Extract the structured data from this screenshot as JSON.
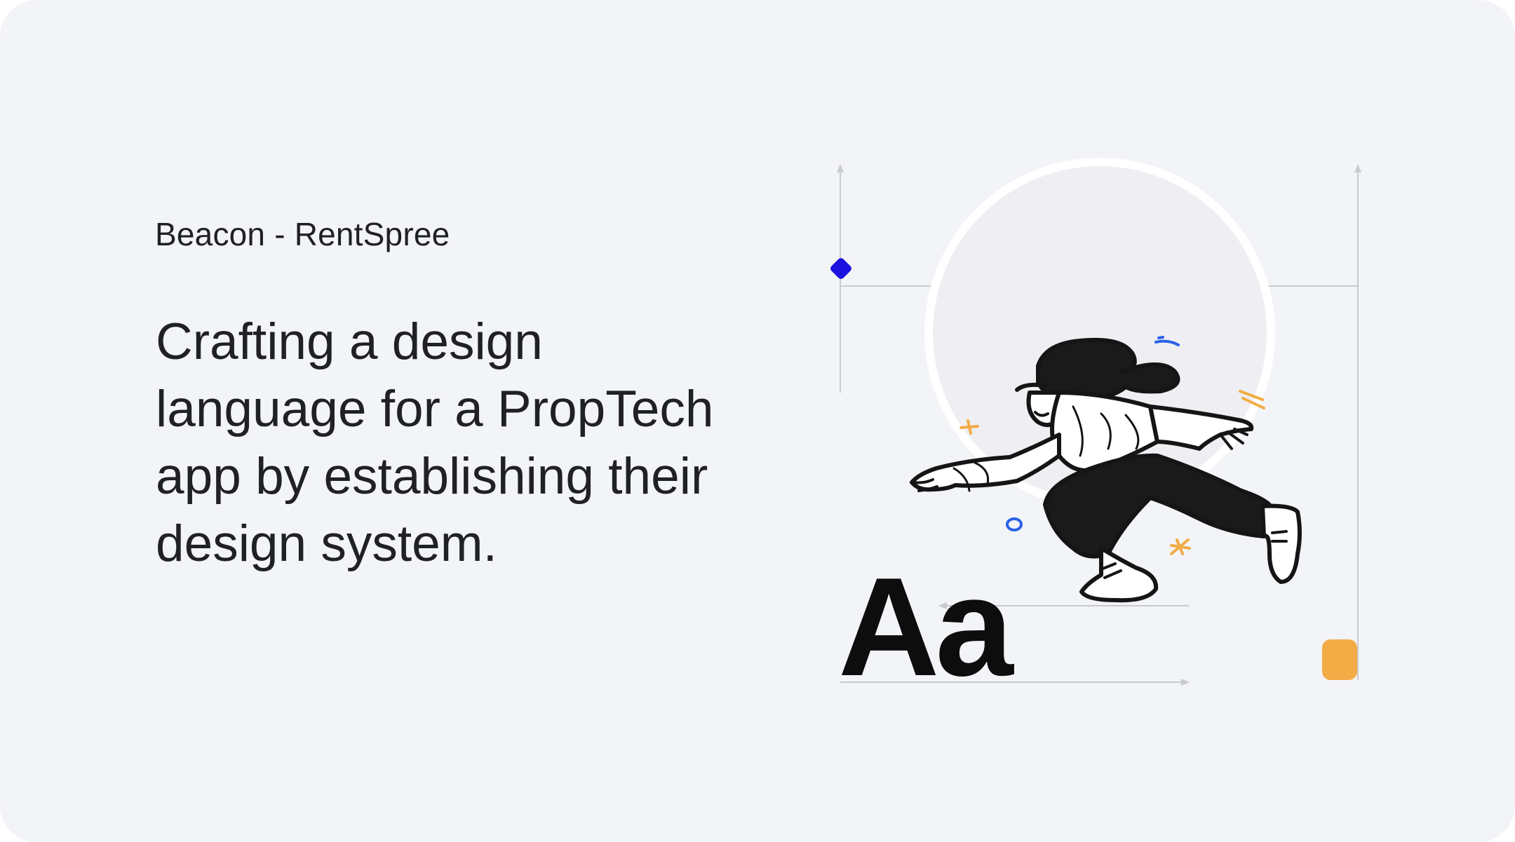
{
  "card": {
    "eyebrow": "Beacon - RentSpree",
    "headline": "Crafting a design language for a PropTech app by establishing their design system.",
    "type_sample": "Aa"
  },
  "colors": {
    "background": "#f3f4f7",
    "text": "#202124",
    "diamond_accent": "#1c12e0",
    "square_accent": "#f2ab45",
    "guide_lines": "#c9cacf",
    "circle_ring": "#ffffff"
  },
  "illustration": {
    "subject": "person-leaping-icon"
  }
}
